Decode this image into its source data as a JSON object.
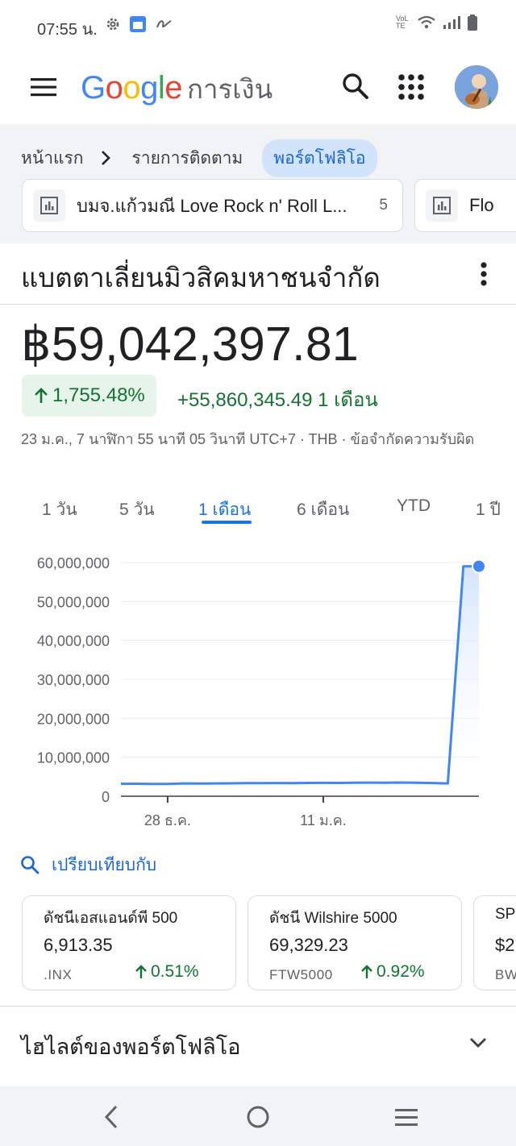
{
  "status": {
    "time": "07:55 น.",
    "left_icons": [
      "gear-icon",
      "calendar-icon",
      "link-icon"
    ],
    "right_icons": [
      "volte-icon",
      "wifi-icon",
      "signal-icon",
      "battery-icon"
    ],
    "volte_text": "VoLTE"
  },
  "header": {
    "logo": "Google",
    "product": "การเงิน",
    "menu_icon": "hamburger-menu-icon",
    "search_icon": "search-icon",
    "apps_icon": "apps-grid-icon"
  },
  "breadcrumb": {
    "home": "หน้าแรก",
    "watchlist": "รายการติดตาม",
    "portfolio": "พอร์ตโฟลิโอ"
  },
  "portfolio_cards": [
    {
      "name": "บมจ.แก้วมณี Love Rock n' Roll L...",
      "count": "5"
    },
    {
      "name": "Flo",
      "count": ""
    }
  ],
  "stock": {
    "title": "แบตตาเลี่ยนมิวสิคมหาชนจำกัด",
    "price": "฿59,042,397.81",
    "change_percent": "1,755.48%",
    "change_abs": "+55,860,345.49 1 เดือน",
    "meta": "23 ม.ค., 7 นาฬิกา 55 นาที 05 วินาที UTC+7 · THB · ข้อจำกัดความรับผิด"
  },
  "tabs": [
    {
      "label": "1 วัน",
      "active": false
    },
    {
      "label": "5 วัน",
      "active": false
    },
    {
      "label": "1 เดือน",
      "active": true
    },
    {
      "label": "6 เดือน",
      "active": false
    },
    {
      "label": "YTD",
      "active": false
    },
    {
      "label": "1 ปี",
      "active": false
    }
  ],
  "chart_data": {
    "type": "area",
    "ylim": [
      0,
      60000000
    ],
    "y_ticks": [
      "60,000,000",
      "50,000,000",
      "40,000,000",
      "30,000,000",
      "20,000,000",
      "10,000,000",
      "0"
    ],
    "y_tick_values": [
      60000000,
      50000000,
      40000000,
      30000000,
      20000000,
      10000000,
      0
    ],
    "x_ticks": [
      "28 ธ.ค.",
      "11 ม.ค."
    ],
    "x_tick_index": [
      3,
      13
    ],
    "values": [
      3182052,
      3200000,
      3150000,
      3170000,
      3300000,
      3250000,
      3280000,
      3320000,
      3350000,
      3380000,
      3400000,
      3360000,
      3420000,
      3440000,
      3410000,
      3460000,
      3500000,
      3480000,
      3510000,
      3450000,
      3400000,
      3300000,
      59000000,
      59042397.81
    ],
    "grid": true,
    "colors": {
      "line": "#4285f4",
      "fill_top": "#d2e3fc",
      "point": "#4285f4"
    }
  },
  "compare": {
    "label": "เปรียบเทียบกับ",
    "cards": [
      {
        "name": "ดัชนีเอสแอนด์พี 500",
        "value": "6,913.35",
        "ticker": ".INX",
        "change": "0.51%"
      },
      {
        "name": "ดัชนี Wilshire 5000",
        "value": "69,329.23",
        "ticker": "FTW5000",
        "change": "0.92%"
      },
      {
        "name": "SP",
        "value": "$2",
        "ticker": "BW",
        "change": ""
      }
    ]
  },
  "highlights": {
    "title": "ไฮไลต์ของพอร์ตโฟลิโอ"
  },
  "colors": {
    "accent": "#1a73e8",
    "positive": "#137333",
    "positive_bg": "#e6f4ea",
    "chip_active_bg": "#d2e3fc"
  }
}
